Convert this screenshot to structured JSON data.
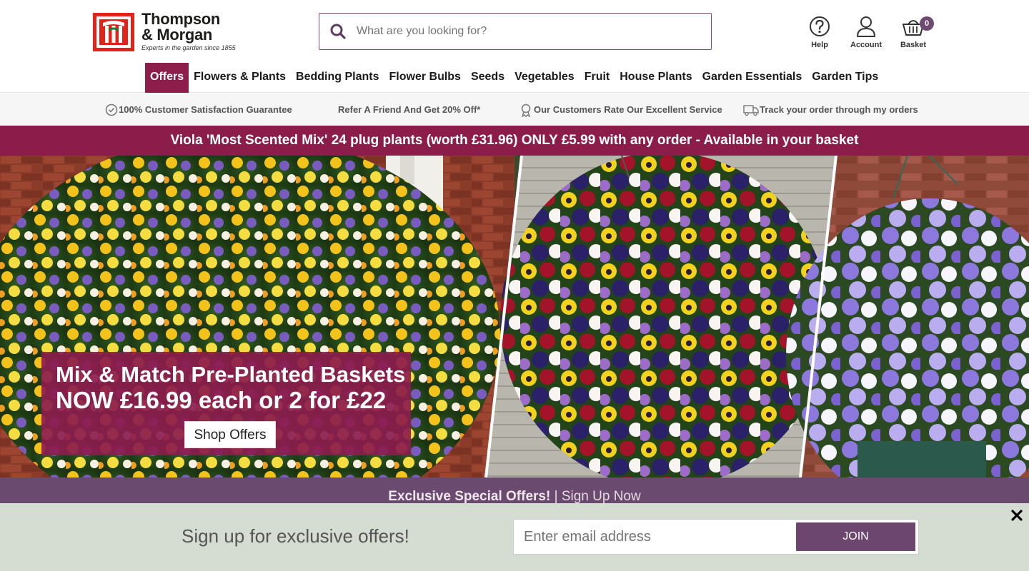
{
  "brand": {
    "name_line1": "Thompson",
    "name_line2": "& Morgan",
    "tagline": "Experts in the garden since 1855",
    "accent": "#8c1d4b",
    "purple": "#6f4a75"
  },
  "search": {
    "placeholder": "What are you looking for?",
    "icon": "search-icon"
  },
  "utility": [
    {
      "label": "Help",
      "icon": "help-icon"
    },
    {
      "label": "Account",
      "icon": "account-icon"
    },
    {
      "label": "Basket",
      "icon": "basket-icon",
      "count": "0"
    }
  ],
  "nav": {
    "items": [
      {
        "label": "Offers",
        "active": true
      },
      {
        "label": "Flowers & Plants"
      },
      {
        "label": "Bedding Plants"
      },
      {
        "label": "Flower Bulbs"
      },
      {
        "label": "Seeds"
      },
      {
        "label": "Vegetables"
      },
      {
        "label": "Fruit"
      },
      {
        "label": "House Plants"
      },
      {
        "label": "Garden Essentials"
      },
      {
        "label": "Garden Tips"
      }
    ]
  },
  "trust": {
    "items": [
      {
        "label": "100% Customer Satisfaction Guarantee",
        "icon": "check-circle-icon"
      },
      {
        "label": "Refer A Friend And Get 20% Off*",
        "icon": ""
      },
      {
        "label": "Our Customers Rate Our Excellent Service",
        "icon": "rosette-icon"
      },
      {
        "label": "Track your order through my orders",
        "icon": "delivery-van-icon"
      }
    ]
  },
  "promo": {
    "text": "Viola 'Most Scented Mix' 24 plug plants (worth £31.96) ONLY £5.99 with any order - Available in your basket"
  },
  "hero": {
    "line1": "Mix & Match Pre-Planted Baskets",
    "line2": "NOW £16.99 each or 2 for £22",
    "button": "Shop Offers"
  },
  "signup_strip": {
    "bold": "Exclusive Special Offers!",
    "rest": "| Sign Up Now"
  },
  "popup": {
    "text": "Sign up for exclusive offers!",
    "email_placeholder": "Enter email address",
    "join_label": "JOIN",
    "close_icon": "close-icon"
  }
}
